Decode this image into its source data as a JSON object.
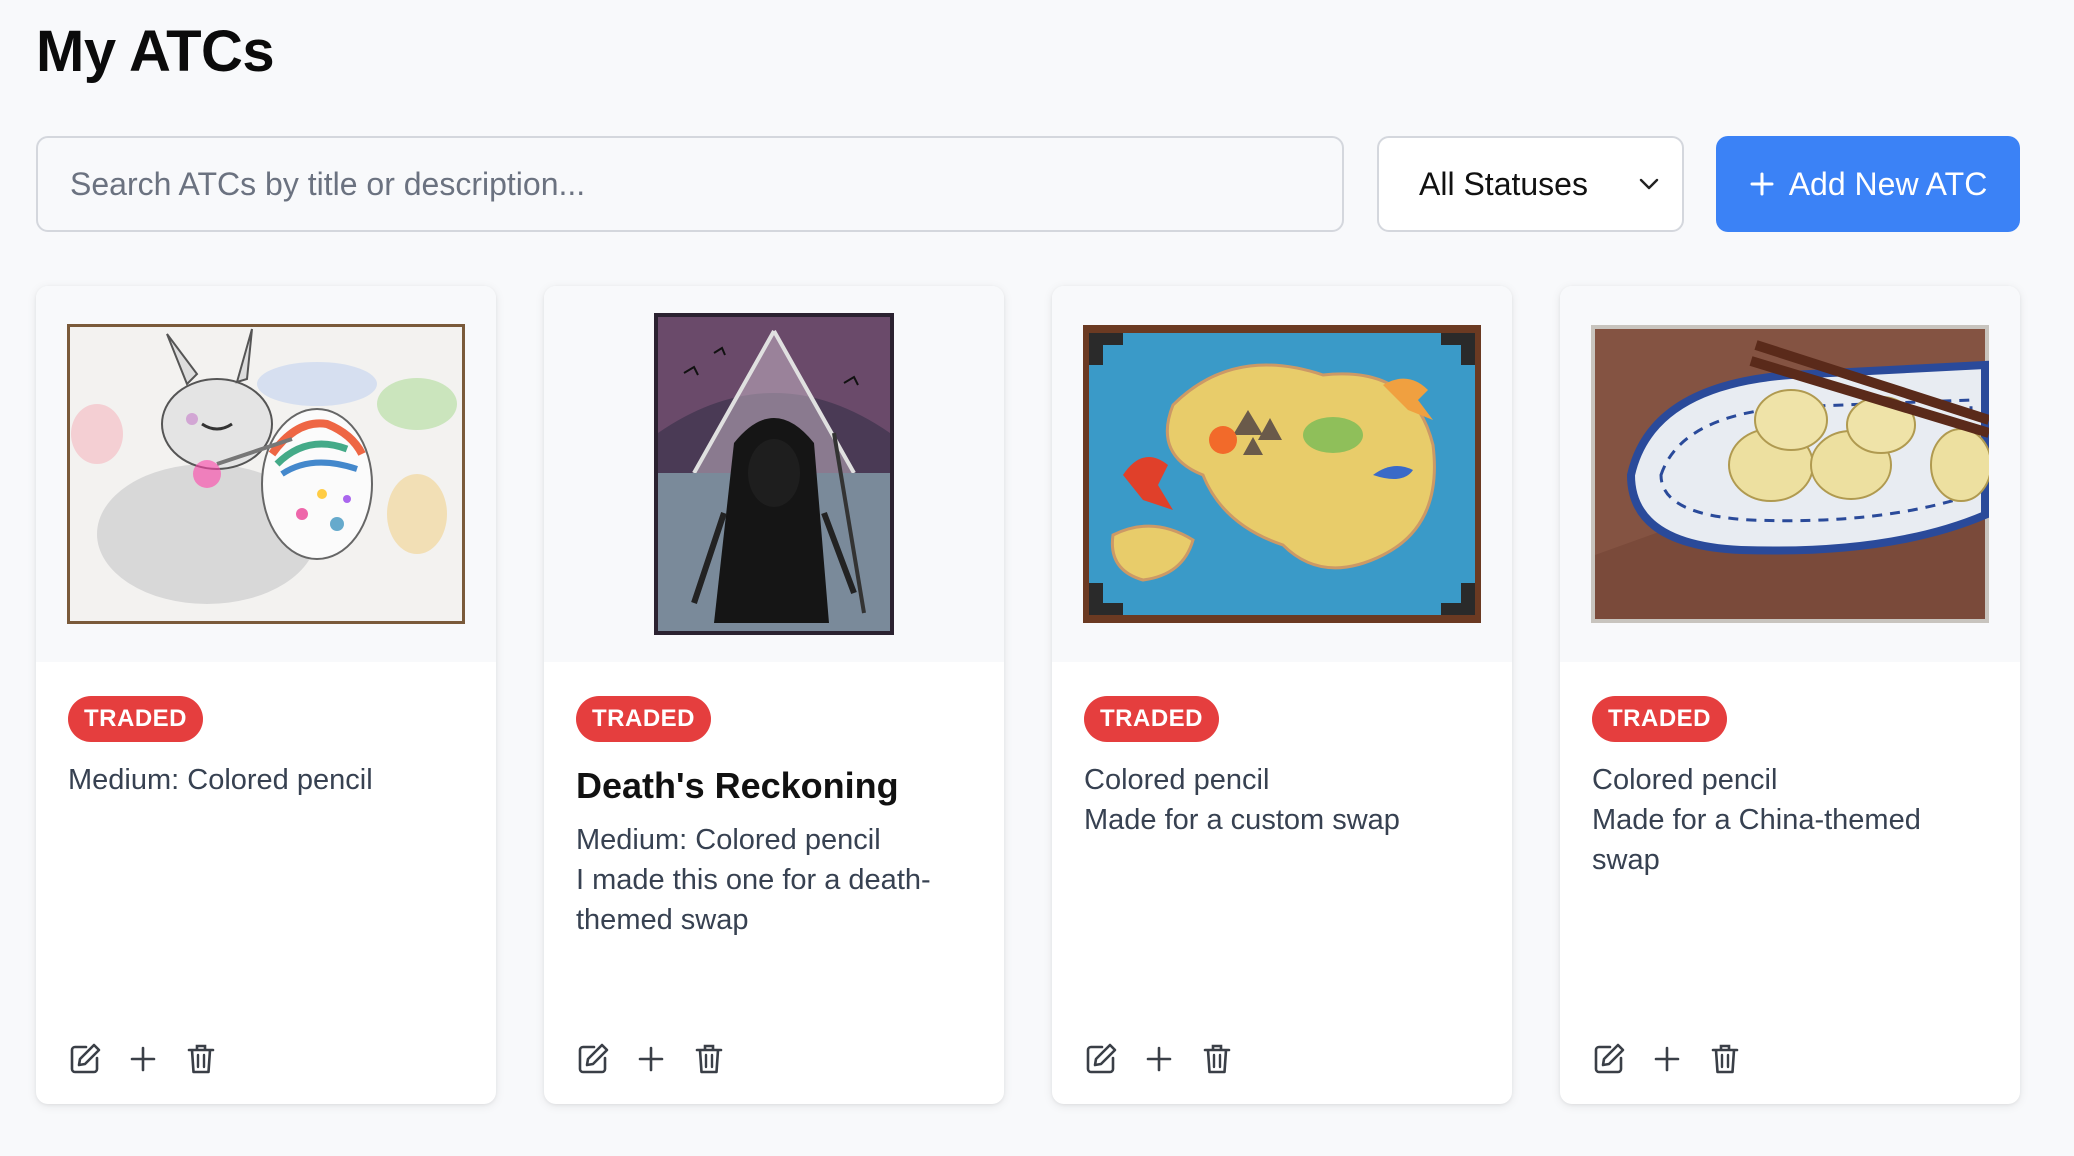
{
  "page": {
    "title": "My ATCs"
  },
  "toolbar": {
    "search_placeholder": "Search ATCs by title or description...",
    "status_filter": "All Statuses",
    "add_label": "Add New ATC",
    "accent_color": "#3b82f6"
  },
  "cards": [
    {
      "status": "TRADED",
      "title": "",
      "description": "Medium: Colored pencil",
      "image": "easter-bunny-painting-egg"
    },
    {
      "status": "TRADED",
      "title": "Death's Reckoning",
      "description": "Medium: Colored pencil\nI made this one for a death-themed swap",
      "image": "hooded-death-figure"
    },
    {
      "status": "TRADED",
      "title": "",
      "description": "Colored pencil\nMade for a custom swap",
      "image": "fantasy-map-with-dragons"
    },
    {
      "status": "TRADED",
      "title": "",
      "description": "Colored pencil\nMade for a China-themed swap",
      "image": "dumplings-on-plate-with-chopsticks"
    }
  ],
  "status_colors": {
    "traded": "#e53e3e"
  },
  "icons": {
    "edit": "edit-icon",
    "add": "plus-icon",
    "delete": "trash-icon"
  }
}
